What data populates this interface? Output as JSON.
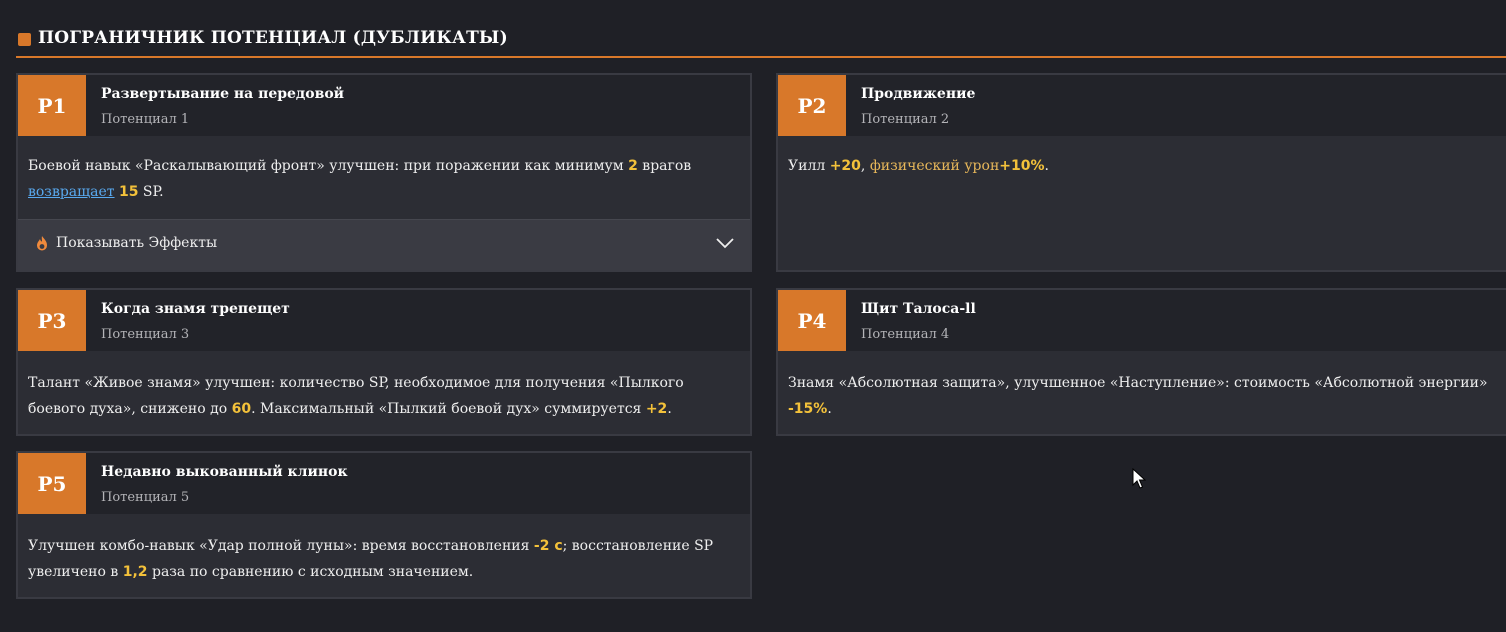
{
  "section": {
    "title": "ПОГРАНИЧНИК ПОТЕНЦИАЛ (ДУБЛИКАТЫ)"
  },
  "cards": [
    {
      "badge": "P1",
      "title": "Развертывание на передовой",
      "subtitle": "Потенциал 1",
      "desc": {
        "t1": "Боевой навык «Раскалывающий фронт» улучшен: при поражении как минимум ",
        "v1": "2",
        "t2": " врагов ",
        "link": "возвращает",
        "t3": " ",
        "v2": "15",
        "t4": " SP."
      },
      "effects_label": "Показывать Эффекты"
    },
    {
      "badge": "P2",
      "title": "Продвижение",
      "subtitle": "Потенциал 2",
      "desc": {
        "t1": "Уилл ",
        "v1": "+20",
        "t2": ", ",
        "v2": "физический урон",
        "v3": "+10%",
        "t3": "."
      }
    },
    {
      "badge": "P3",
      "title": "Когда знамя трепещет",
      "subtitle": "Потенциал 3",
      "desc": {
        "t1": "Талант «Живое знамя» улучшен: количество SP, необходимое для получения «Пылкого боевого духа», снижено до ",
        "v1": "60",
        "t2": ". Максимальный «Пылкий боевой дух» суммируется ",
        "v2": "+2",
        "t3": "."
      }
    },
    {
      "badge": "P4",
      "title": "Щит Талоса-ll",
      "subtitle": "Потенциал 4",
      "desc": {
        "t1": "Знамя «Абсолютная защита», улучшенное «Наступление»: стоимость «Абсолютной энергии» ",
        "v1": "-15%",
        "t2": "."
      }
    },
    {
      "badge": "P5",
      "title": "Недавно выкованный клинок",
      "subtitle": "Потенциал 5",
      "desc": {
        "t1": "Улучшен комбо-навык «Удар полной луны»: время восстановления ",
        "v1": "-2 с",
        "t2": "; восстановление SP увеличено в ",
        "v2": "1,2",
        "t3": " раза по сравнению с исходным значением."
      }
    }
  ],
  "colors": {
    "accent": "#d8782a",
    "highlight": "#f3c13a",
    "link": "#59a9ef",
    "background": "#1f2026",
    "card": "#2c2d34"
  },
  "icons": {
    "section": "orange-square-icon",
    "effects": "flame-icon",
    "toggle": "chevron-down-icon",
    "cursor": "mouse-pointer-icon"
  }
}
